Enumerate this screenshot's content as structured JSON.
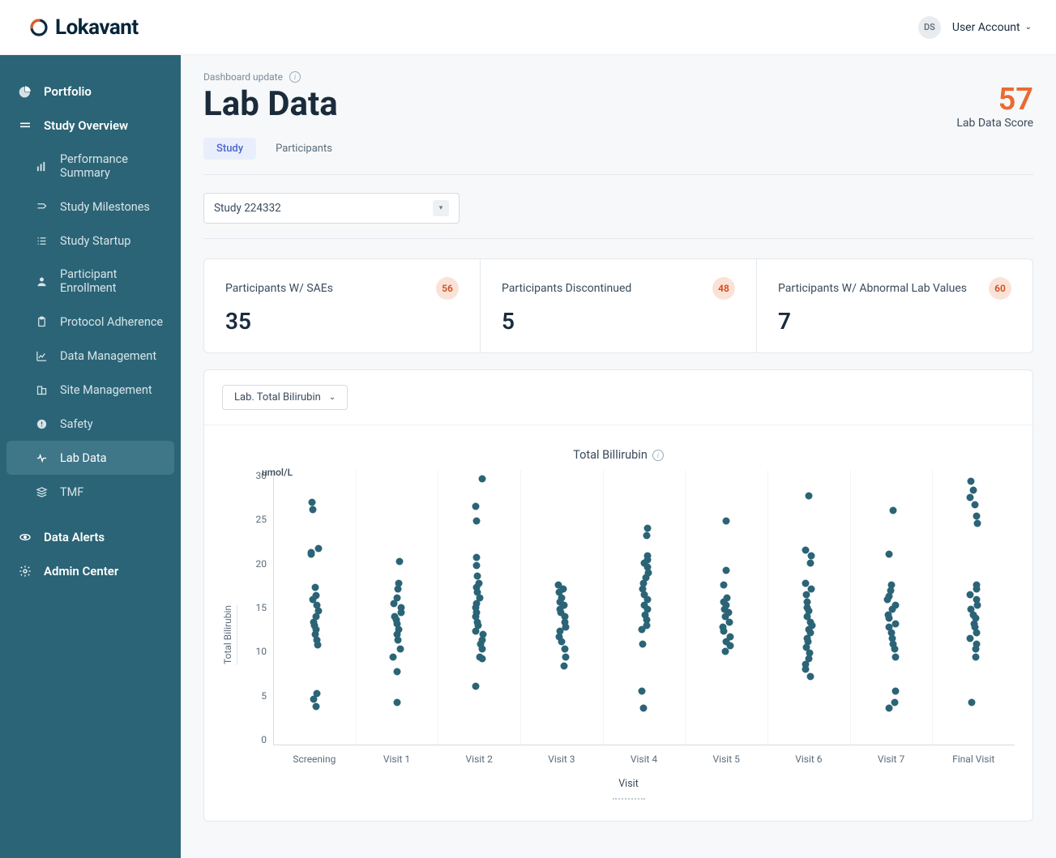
{
  "brand": "Lokavant",
  "user": {
    "initials": "DS",
    "account_label": "User Account"
  },
  "sidebar": {
    "portfolio": "Portfolio",
    "study_overview": "Study Overview",
    "items": [
      "Performance Summary",
      "Study Milestones",
      "Study Startup",
      "Participant Enrollment",
      "Protocol Adherence",
      "Data Management",
      "Site Management",
      "Safety",
      "Lab Data",
      "TMF"
    ],
    "data_alerts": "Data Alerts",
    "admin_center": "Admin Center"
  },
  "breadcrumb": "Dashboard update",
  "page_title": "Lab Data",
  "score": {
    "value": "57",
    "label": "Lab Data Score"
  },
  "tabs": {
    "study": "Study",
    "participants": "Participants"
  },
  "study_select": "Study 224332",
  "kpis": [
    {
      "label": "Participants W/ SAEs",
      "badge": "56",
      "value": "35"
    },
    {
      "label": "Participants Discontinued",
      "badge": "48",
      "value": "5"
    },
    {
      "label": "Participants W/ Abnormal Lab Values",
      "badge": "60",
      "value": "7"
    }
  ],
  "lab_select": "Lab. Total Bilirubin",
  "chart": {
    "title": "Total Billirubin",
    "unit": "umol/L",
    "y_label": "Total Bilirubin",
    "x_label": "Visit",
    "y_ticks": [
      "30",
      "25",
      "20",
      "15",
      "10",
      "5",
      "0"
    ]
  },
  "chart_data": {
    "type": "scatter",
    "title": "Total Billirubin",
    "ylabel": "Total Bilirubin",
    "xlabel": "Visit",
    "unit": "umol/L",
    "ylim": [
      0,
      30
    ],
    "categories": [
      "Screening",
      "Visit 1",
      "Visit 2",
      "Visit 3",
      "Visit 4",
      "Visit 5",
      "Visit 6",
      "Visit 7",
      "Final Visit"
    ],
    "series": [
      {
        "name": "Screening",
        "values": [
          26.5,
          25.7,
          21.4,
          21.0,
          20.8,
          17.2,
          16.3,
          15.8,
          15.2,
          14.6,
          14.0,
          13.4,
          13.0,
          12.6,
          12.0,
          11.4,
          10.9,
          5.6,
          5.0,
          4.2
        ]
      },
      {
        "name": "Visit 1",
        "values": [
          20.0,
          17.6,
          17.0,
          16.0,
          15.4,
          15.0,
          14.4,
          14.0,
          13.6,
          13.2,
          12.6,
          12.0,
          11.4,
          10.4,
          9.6,
          8.0,
          4.6
        ]
      },
      {
        "name": "Visit 2",
        "values": [
          29.0,
          26.0,
          24.4,
          20.4,
          19.6,
          18.4,
          17.6,
          17.2,
          16.6,
          16.0,
          15.4,
          15.0,
          14.4,
          14.0,
          13.4,
          13.0,
          12.4,
          12.0,
          11.4,
          11.0,
          10.4,
          9.6,
          9.4,
          6.4
        ]
      },
      {
        "name": "Visit 3",
        "values": [
          17.4,
          17.0,
          16.6,
          16.0,
          15.6,
          15.2,
          14.8,
          14.4,
          14.0,
          13.4,
          12.8,
          12.4,
          11.8,
          11.2,
          10.4,
          9.6,
          8.6
        ]
      },
      {
        "name": "Visit 4",
        "values": [
          23.6,
          22.8,
          20.6,
          20.2,
          19.8,
          19.4,
          18.8,
          18.2,
          17.6,
          17.0,
          16.4,
          15.8,
          15.2,
          14.8,
          14.2,
          13.6,
          13.0,
          12.6,
          11.0,
          5.8,
          4.0
        ]
      },
      {
        "name": "Visit 5",
        "values": [
          24.4,
          19.0,
          17.4,
          16.0,
          15.6,
          15.2,
          14.8,
          14.4,
          14.0,
          13.4,
          12.8,
          12.4,
          11.8,
          11.2,
          10.8,
          10.2
        ]
      },
      {
        "name": "Visit 6",
        "values": [
          27.2,
          21.2,
          20.6,
          19.8,
          17.6,
          17.0,
          16.4,
          15.6,
          15.0,
          14.6,
          14.0,
          13.4,
          13.0,
          12.6,
          12.2,
          11.6,
          11.2,
          10.6,
          10.0,
          9.4,
          8.8,
          8.2,
          7.4
        ]
      },
      {
        "name": "Visit 7",
        "values": [
          25.6,
          20.8,
          17.4,
          16.8,
          16.2,
          15.8,
          15.2,
          14.8,
          14.2,
          13.8,
          13.2,
          12.8,
          12.2,
          11.6,
          11.0,
          10.4,
          9.6,
          5.8,
          4.6,
          4.0
        ]
      },
      {
        "name": "Final Visit",
        "values": [
          28.8,
          27.8,
          27.0,
          26.2,
          25.0,
          24.2,
          17.4,
          17.0,
          16.4,
          15.8,
          15.2,
          14.8,
          14.2,
          13.8,
          13.2,
          12.8,
          12.2,
          11.6,
          11.0,
          10.4,
          9.6,
          4.6
        ]
      }
    ]
  }
}
